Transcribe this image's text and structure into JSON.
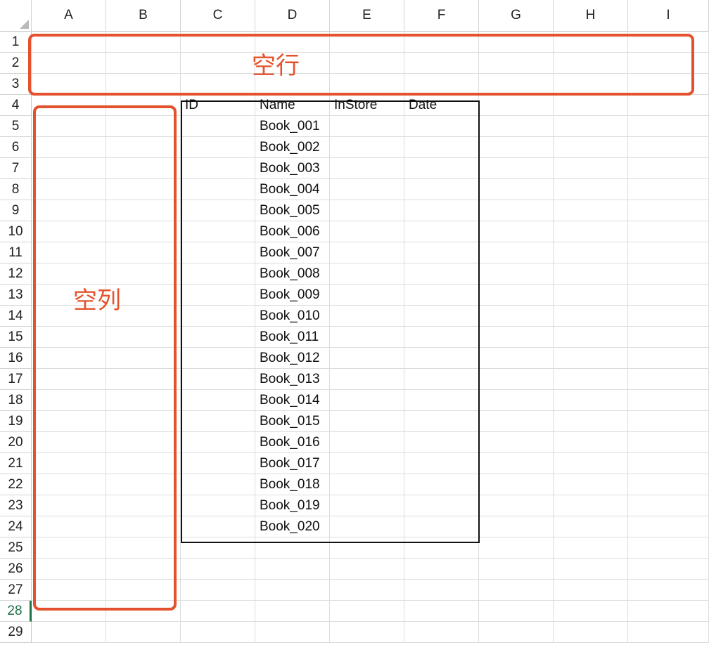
{
  "columns": [
    "A",
    "B",
    "C",
    "D",
    "E",
    "F",
    "G",
    "H",
    "I"
  ],
  "rows": [
    "1",
    "2",
    "3",
    "4",
    "5",
    "6",
    "7",
    "8",
    "9",
    "10",
    "11",
    "12",
    "13",
    "14",
    "15",
    "16",
    "17",
    "18",
    "19",
    "20",
    "21",
    "22",
    "23",
    "24",
    "25",
    "26",
    "27",
    "28",
    "29"
  ],
  "active_row": "28",
  "table": {
    "headers": [
      "ID",
      "Name",
      "InStore",
      "Date"
    ],
    "names": [
      "Book_001",
      "Book_002",
      "Book_003",
      "Book_004",
      "Book_005",
      "Book_006",
      "Book_007",
      "Book_008",
      "Book_009",
      "Book_010",
      "Book_011",
      "Book_012",
      "Book_013",
      "Book_014",
      "Book_015",
      "Book_016",
      "Book_017",
      "Book_018",
      "Book_019",
      "Book_020"
    ]
  },
  "annotations": {
    "empty_rows_label": "空行",
    "empty_cols_label": "空列",
    "color": "#e4522d"
  }
}
